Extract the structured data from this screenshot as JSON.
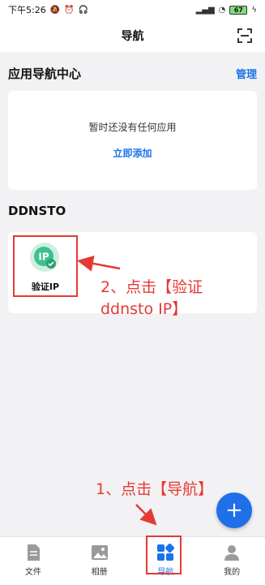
{
  "status_bar": {
    "time": "下午5:26",
    "battery": "67"
  },
  "header": {
    "title": "导航"
  },
  "section_apps": {
    "title": "应用导航中心",
    "manage_label": "管理"
  },
  "empty_state": {
    "message": "暂时还没有任何应用",
    "add_label": "立即添加"
  },
  "section_ddnsto": {
    "title": "DDNSTO"
  },
  "app_tile": {
    "icon": "verify-ip-icon",
    "label": "验证IP"
  },
  "annotations": {
    "step2_line1": "2、点击【验证",
    "step2_line2": "ddnsto IP】",
    "step1": "1、点击【导航】"
  },
  "fab": {
    "label": "+"
  },
  "tabs": [
    {
      "label": "文件",
      "icon": "file-icon"
    },
    {
      "label": "相册",
      "icon": "image-icon"
    },
    {
      "label": "导航",
      "icon": "grid-icon",
      "active": true
    },
    {
      "label": "我的",
      "icon": "person-icon"
    }
  ],
  "colors": {
    "accent": "#1a73e8",
    "annotation": "#e53935",
    "fab": "#1e6fe8"
  }
}
